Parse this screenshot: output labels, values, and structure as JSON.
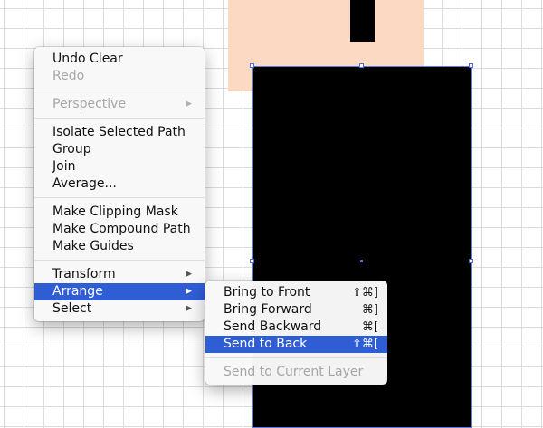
{
  "main_menu": {
    "groups": [
      [
        {
          "label": "Undo Clear",
          "disabled": false
        },
        {
          "label": "Redo",
          "disabled": true
        }
      ],
      [
        {
          "label": "Perspective",
          "disabled": true,
          "submenu": true
        }
      ],
      [
        {
          "label": "Isolate Selected Path",
          "disabled": false
        },
        {
          "label": "Group",
          "disabled": false
        },
        {
          "label": "Join",
          "disabled": false
        },
        {
          "label": "Average...",
          "disabled": false
        }
      ],
      [
        {
          "label": "Make Clipping Mask",
          "disabled": false
        },
        {
          "label": "Make Compound Path",
          "disabled": false
        },
        {
          "label": "Make Guides",
          "disabled": false
        }
      ],
      [
        {
          "label": "Transform",
          "disabled": false,
          "submenu": true
        },
        {
          "label": "Arrange",
          "disabled": false,
          "submenu": true,
          "highlighted": true
        },
        {
          "label": "Select",
          "disabled": false,
          "submenu": true
        }
      ]
    ]
  },
  "arrange_submenu": {
    "items": [
      {
        "label": "Bring to Front",
        "shortcut": "⇧⌘]"
      },
      {
        "label": "Bring Forward",
        "shortcut": "⌘]"
      },
      {
        "label": "Send Backward",
        "shortcut": "⌘["
      },
      {
        "label": "Send to Back",
        "shortcut": "⇧⌘[",
        "highlighted": true
      },
      {
        "label": "Send to Current Layer",
        "disabled": true
      }
    ]
  },
  "icons": {
    "submenu_arrow": "triangle-right-icon"
  },
  "colors": {
    "highlight": "#2f5dd4",
    "selection": "#4f6fe0",
    "peach_shape": "#fbd9c3",
    "black_shape": "#000000"
  }
}
